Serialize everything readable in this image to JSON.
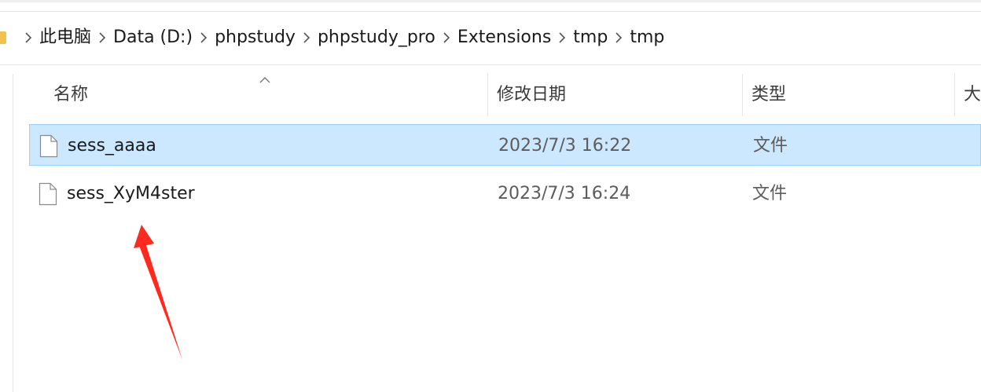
{
  "breadcrumb": [
    "此电脑",
    "Data (D:)",
    "phpstudy",
    "phpstudy_pro",
    "Extensions",
    "tmp",
    "tmp"
  ],
  "columns": {
    "name": "名称",
    "modified": "修改日期",
    "type": "类型",
    "size": "大"
  },
  "files": [
    {
      "name": "sess_aaaa",
      "modified": "2023/7/3 16:22",
      "type": "文件",
      "selected": true
    },
    {
      "name": "sess_XyM4ster",
      "modified": "2023/7/3 16:24",
      "type": "文件",
      "selected": false
    }
  ],
  "colors": {
    "selection_bg": "#cce8ff",
    "selection_border": "#99d1ff",
    "annotation_arrow": "#ff2a1f"
  }
}
